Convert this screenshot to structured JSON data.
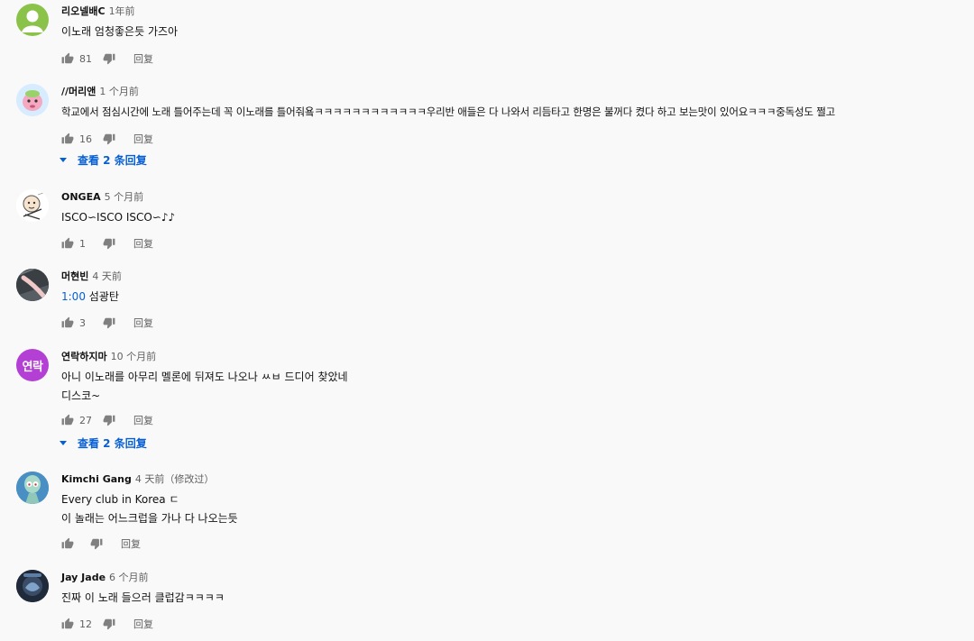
{
  "comments": [
    {
      "author": "리오넬배C",
      "time": "1年前",
      "lines": [
        "이노래 엄청좋은듯 가즈아"
      ],
      "likes": "81",
      "reply_label": "回复",
      "avatar": {
        "icon": "default-person-icon",
        "bg": "#8bc34a"
      }
    },
    {
      "author": "//머리앤",
      "time": "1 个月前",
      "lines": [
        "학교에서 점심시간에 노래 틀어주는데 꼭 이노래를 틀어줘욬ㅋㅋㅋㅋㅋㅋㅋㅋㅋㅋㅋㅋ우리반 애들은 다 나와서 리듬타고 한명은 불꺼다 켰다 하고 보는맛이 있어요ㅋㅋㅋ중독성도 쩔고"
      ],
      "likes": "16",
      "reply_label": "回复",
      "view_replies": "查看 2 条回复",
      "avatar": {
        "icon": "cartoon-pink-avatar-icon",
        "bg": "#cfe8ff"
      }
    },
    {
      "author": "ONGEA",
      "time": "5 个月前",
      "lines": [
        "ISCO∽ISCO ISCO∽♪♪"
      ],
      "likes": "1",
      "reply_label": "回复",
      "avatar": {
        "icon": "cartoon-character-avatar-icon",
        "bg": "#ffffff"
      }
    },
    {
      "author": "머현빈",
      "time": "4 天前",
      "timestamp": "1:00",
      "lines": [
        " 섬광탄"
      ],
      "likes": "3",
      "reply_label": "回复",
      "avatar": {
        "icon": "photo-avatar-icon",
        "bg": "#3a3f44"
      }
    },
    {
      "author": "연락하지마",
      "time": "10 个月前",
      "lines": [
        "아니 이노래를 아무리 멜론에 뒤져도 나오나 ㅆㅂ 드디어 찾았네",
        "디스코~"
      ],
      "likes": "27",
      "reply_label": "回复",
      "view_replies": "查看 2 条回复",
      "avatar": {
        "initials": "연락",
        "bg": "#b43fd4"
      }
    },
    {
      "author": "Kimchi Gang",
      "time": "4 天前（修改过）",
      "lines": [
        "Every club in Korea ㄷ",
        "이 놀래는 어느크럽을 가나 다 나오는듯"
      ],
      "likes": "",
      "reply_label": "回复",
      "avatar": {
        "icon": "squidward-avatar-icon",
        "bg": "#4a8fc4"
      }
    },
    {
      "author": "Jay Jade",
      "time": "6 个月前",
      "lines": [
        "진짜 이 노래 들으러 클럽감ㅋㅋㅋㅋ"
      ],
      "likes": "12",
      "reply_label": "回复",
      "avatar": {
        "icon": "dark-logo-avatar-icon",
        "bg": "#1f2a3a"
      }
    }
  ],
  "colors": {
    "background": "#f9f9f9",
    "text": "#111111",
    "meta": "#606060",
    "link": "#065fd4"
  }
}
